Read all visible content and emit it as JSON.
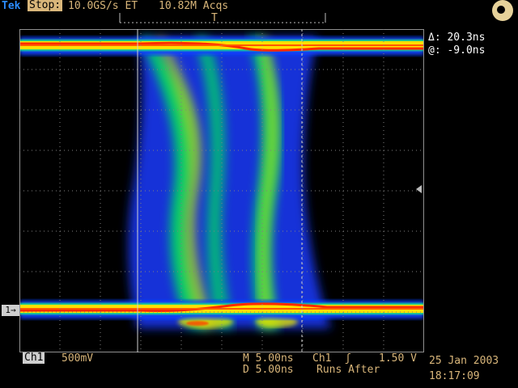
{
  "header": {
    "brand": "Tek",
    "run_state": "Stop:",
    "sample_rate": "10.0GS/s ET",
    "acquisitions": "10.82M Acqs",
    "trigger_position_label": "T"
  },
  "measurements": {
    "delta": "Δ: 20.3ns",
    "at": "@: -9.0ns"
  },
  "footer": {
    "channel_label": "Ch1",
    "channel_scale": "500mV",
    "main_timebase": "M 5.00ns",
    "delay_timebase": "D 5.00ns",
    "trigger_source": "Ch1",
    "trigger_slope": "ʃ",
    "trigger_level": "1.50 V",
    "trigger_mode": "Runs After",
    "date": "25 Jan 2003",
    "time": "18:17:09"
  },
  "channel_marker": "1→",
  "colors": {
    "readout": "#d9b67a",
    "brand": "#2c8cff",
    "grid": "#808080",
    "trace_hot": "#ff2a00",
    "trace_mid": "#ffd000",
    "trace_cool": "#00d060",
    "trace_cold": "#1030ff"
  },
  "icons": {
    "trigger_status": "trigger-status-icon",
    "trigger_level_marker": "trigger-level-arrow-icon"
  }
}
